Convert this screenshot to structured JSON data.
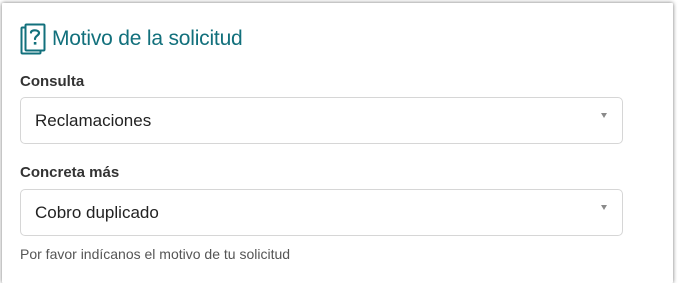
{
  "section": {
    "title": "Motivo de la solicitud",
    "icon": "question-book-icon",
    "accent_color": "#12707c"
  },
  "fields": [
    {
      "label": "Consulta",
      "value": "Reclamaciones"
    },
    {
      "label": "Concreta más",
      "value": "Cobro duplicado"
    }
  ],
  "helper_text": "Por favor indícanos el motivo de tu solicitud"
}
